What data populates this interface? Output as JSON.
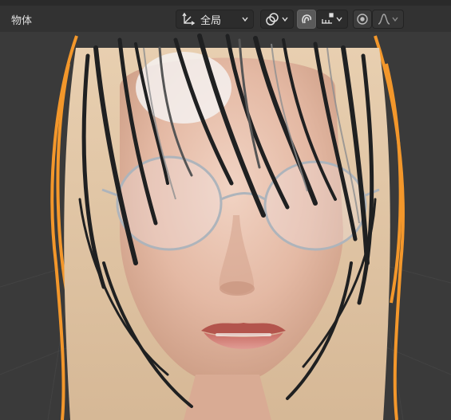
{
  "header": {
    "mode_label": "物体",
    "transform_orientation": {
      "icon": "transform-axes-icon",
      "value": "全局"
    },
    "pivot": {
      "icon": "pivot-link-icon"
    },
    "snap": {
      "icon": "magnet-snap-icon",
      "active": true
    },
    "snap_target": {
      "icon": "snap-increment-icon"
    },
    "proportional_editing": {
      "icon": "proportional-editing-icon"
    },
    "falloff": {
      "icon": "falloff-curve-icon"
    }
  },
  "colors": {
    "selection_outline": "#f3972b",
    "background": "#3a3a3a",
    "header_bg": "#2b2b2b"
  }
}
